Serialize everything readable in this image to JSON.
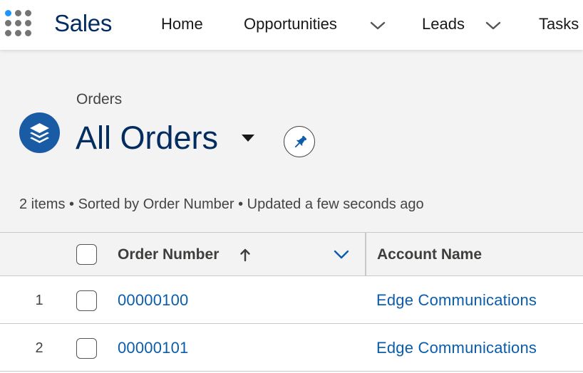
{
  "app": {
    "name": "Sales",
    "nav": [
      {
        "label": "Home",
        "has_menu": false
      },
      {
        "label": "Opportunities",
        "has_menu": true
      },
      {
        "label": "Leads",
        "has_menu": true
      },
      {
        "label": "Tasks",
        "has_menu": false
      }
    ]
  },
  "list_header": {
    "object_label": "Orders",
    "view_name": "All Orders",
    "icon": "stack-layers-icon",
    "meta": "2 items • Sorted by Order Number • Updated a few seconds ago"
  },
  "table": {
    "columns": [
      {
        "label": "Order Number",
        "sorted": "ascending"
      },
      {
        "label": "Account Name"
      }
    ],
    "rows": [
      {
        "num": "1",
        "order_number": "00000100",
        "account_name": "Edge Communications"
      },
      {
        "num": "2",
        "order_number": "00000101",
        "account_name": "Edge Communications"
      }
    ]
  },
  "colors": {
    "brand_navy": "#032d60",
    "link_blue": "#0b5cab",
    "object_icon_bg": "#1a5ba5",
    "waffle_blue": "#1b96ff",
    "waffle_gray": "#747474"
  }
}
